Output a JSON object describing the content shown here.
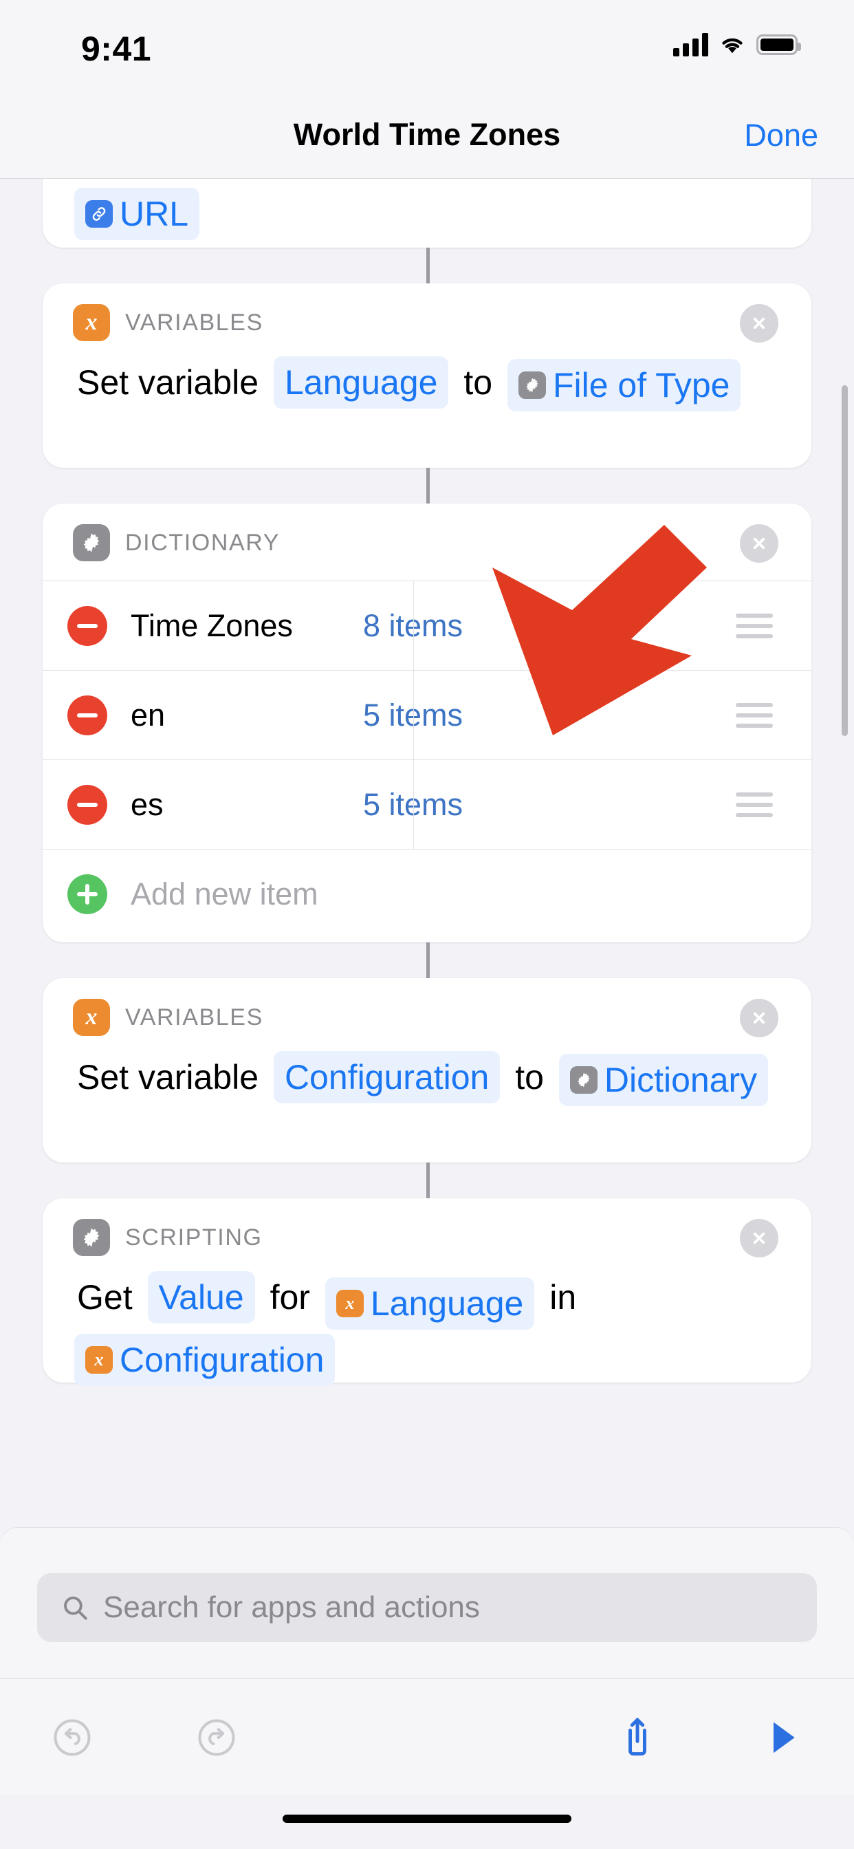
{
  "statusbar": {
    "time": "9:41",
    "signal_icon": "cellular-signal-icon",
    "wifi_icon": "wifi-icon",
    "battery_icon": "battery-icon"
  },
  "navbar": {
    "title": "World Time Zones",
    "done_label": "Done"
  },
  "colors": {
    "accent_blue": "#1a76f2",
    "token_blue": "#3d74c4",
    "variables_orange": "#ec8b2f",
    "gear_gray": "#8e8e93",
    "url_blue": "#3b7de9",
    "delete_red": "#e8412e",
    "add_green": "#55c461",
    "annotation_red": "#e03a20"
  },
  "actions": [
    {
      "id": "url-action",
      "category": "",
      "icon": "url-icon",
      "tokens": [
        {
          "type": "token",
          "icon": "url-icon",
          "icon_style": "url",
          "text": "URL"
        }
      ]
    },
    {
      "id": "set-variable-language",
      "category": "VARIABLES",
      "icon": "variables-x-icon",
      "icon_style": "var",
      "close_icon": "close-circle-icon",
      "tokens": [
        {
          "type": "plain",
          "text": "Set variable"
        },
        {
          "type": "token",
          "text": "Language"
        },
        {
          "type": "plain",
          "text": "to"
        },
        {
          "type": "token",
          "icon": "gear-icon",
          "icon_style": "gear",
          "text": "File of Type"
        }
      ]
    },
    {
      "id": "dictionary-action",
      "category": "DICTIONARY",
      "icon": "gear-icon",
      "icon_style": "gear",
      "close_icon": "close-circle-icon",
      "rows": [
        {
          "key": "Time Zones",
          "value": "8 items",
          "remove_icon": "minus-circle-icon",
          "grip_icon": "drag-handle-icon"
        },
        {
          "key": "en",
          "value": "5 items",
          "remove_icon": "minus-circle-icon",
          "grip_icon": "drag-handle-icon"
        },
        {
          "key": "es",
          "value": "5 items",
          "remove_icon": "minus-circle-icon",
          "grip_icon": "drag-handle-icon"
        }
      ],
      "add_row": {
        "key": "Add new item",
        "add_icon": "plus-circle-icon"
      }
    },
    {
      "id": "set-variable-configuration",
      "category": "VARIABLES",
      "icon": "variables-x-icon",
      "icon_style": "var",
      "close_icon": "close-circle-icon",
      "tokens": [
        {
          "type": "plain",
          "text": "Set variable"
        },
        {
          "type": "token",
          "text": "Configuration"
        },
        {
          "type": "plain",
          "text": "to"
        },
        {
          "type": "token",
          "icon": "gear-icon",
          "icon_style": "gear",
          "text": "Dictionary"
        }
      ]
    },
    {
      "id": "get-value-action",
      "category": "SCRIPTING",
      "icon": "gear-icon",
      "icon_style": "gear",
      "close_icon": "close-circle-icon",
      "tokens": [
        {
          "type": "plain",
          "text": "Get"
        },
        {
          "type": "token",
          "text": "Value"
        },
        {
          "type": "plain",
          "text": "for"
        },
        {
          "type": "token",
          "icon": "variables-x-icon",
          "icon_style": "var",
          "text": "Language"
        },
        {
          "type": "plain",
          "text": "in"
        },
        {
          "type": "token",
          "icon": "variables-x-icon",
          "icon_style": "var",
          "text": "Configuration"
        }
      ]
    }
  ],
  "search": {
    "placeholder": "Search for apps and actions",
    "icon": "search-icon",
    "value": ""
  },
  "toolbar": {
    "undo": {
      "icon": "undo-icon",
      "enabled": false
    },
    "redo": {
      "icon": "redo-icon",
      "enabled": false
    },
    "share": {
      "icon": "share-icon",
      "enabled": true
    },
    "play": {
      "icon": "play-icon",
      "enabled": true
    }
  },
  "annotation": {
    "arrow_icon": "red-pointer-arrow",
    "points_at": "8 items"
  }
}
